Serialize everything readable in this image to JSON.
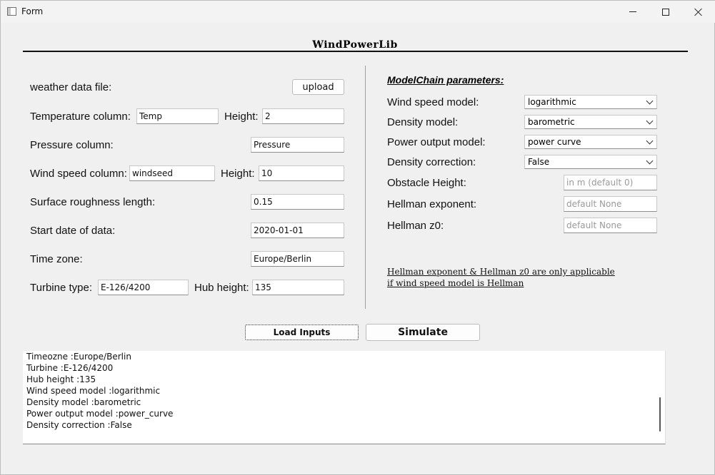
{
  "window": {
    "title": "Form"
  },
  "app_title": "WindPowerLib",
  "left": {
    "weather_label": "weather data file:",
    "upload_label": "upload",
    "temp_label": "Temperature column:",
    "temp_value": "Temp",
    "temp_height_label": "Height:",
    "temp_height_value": "2",
    "pressure_label": "Pressure column:",
    "pressure_value": "Pressure",
    "wind_label": "Wind speed column:",
    "wind_value": "windseed",
    "wind_height_label": "Height:",
    "wind_height_value": "10",
    "roughness_label": "Surface roughness length:",
    "roughness_value": "0.15",
    "start_label": "Start date of data:",
    "start_value": "2020-01-01",
    "tz_label": "Time zone:",
    "tz_value": "Europe/Berlin",
    "turbine_label": "Turbine type:",
    "turbine_value": "E-126/4200",
    "hub_label": "Hub height:",
    "hub_value": "135"
  },
  "right": {
    "section_title": "ModelChain parameters:",
    "wind_model_label": "Wind speed model:",
    "wind_model_value": "logarithmic",
    "density_model_label": "Density model:",
    "density_model_value": "barometric",
    "power_model_label": "Power output model:",
    "power_model_value": "power curve",
    "density_corr_label": "Density correction:",
    "density_corr_value": "False",
    "obstacle_label": "Obstacle Height:",
    "obstacle_placeholder": "in m (default 0)",
    "hellman_exp_label": "Hellman exponent:",
    "hellman_exp_placeholder": "default None",
    "hellman_z0_label": "Hellman z0:",
    "hellman_z0_placeholder": "default None",
    "note_line1": "Hellman exponent & Hellman z0 are only applicable ",
    "note_line2": "if wind speed model is Hellman"
  },
  "actions": {
    "load_label": "Load Inputs",
    "simulate_label": "Simulate"
  },
  "log": {
    "lines": [
      "Timeozne :Europe/Berlin",
      "Turbine :E-126/4200",
      "Hub height :135",
      "Wind speed model :logarithmic",
      "Density model :barometric",
      "Power output model :power_curve",
      "Density correction :False"
    ]
  }
}
